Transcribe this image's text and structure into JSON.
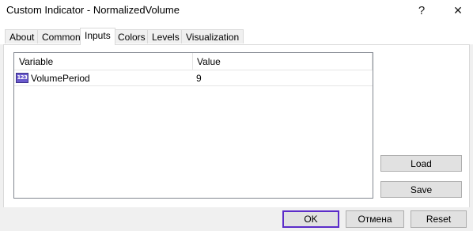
{
  "window": {
    "title": "Custom Indicator - NormalizedVolume",
    "help_glyph": "?",
    "close_glyph": "✕"
  },
  "tabs": [
    {
      "label": "About"
    },
    {
      "label": "Common"
    },
    {
      "label": "Inputs",
      "active": true
    },
    {
      "label": "Colors"
    },
    {
      "label": "Levels"
    },
    {
      "label": "Visualization"
    }
  ],
  "grid": {
    "columns": [
      "Variable",
      "Value"
    ],
    "rows": [
      {
        "icon": "integer-type-icon",
        "icon_text": "123",
        "variable": "VolumePeriod",
        "value": "9"
      }
    ]
  },
  "side_buttons": {
    "load_label": "Load",
    "save_label": "Save"
  },
  "footer": {
    "ok_label": "OK",
    "cancel_label": "Отмена",
    "reset_label": "Reset"
  },
  "colors": {
    "default_button_border": "#5b2cc9",
    "int_icon": "#6a5acd"
  }
}
